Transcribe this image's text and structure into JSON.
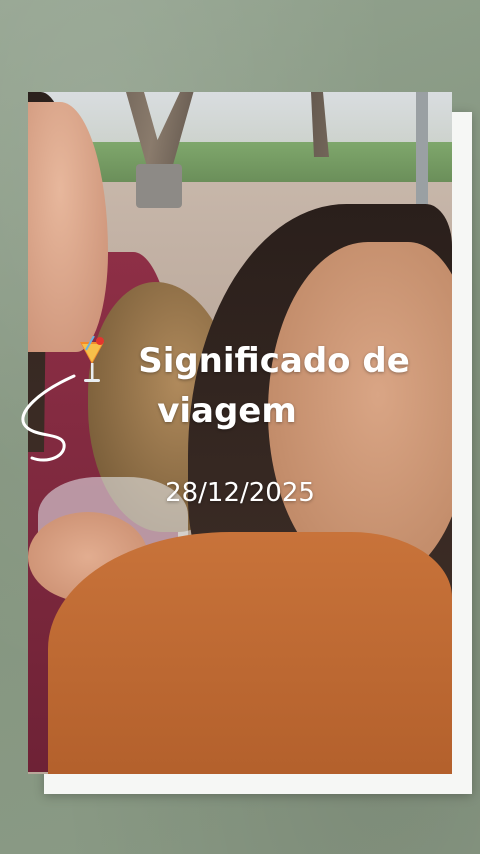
{
  "story": {
    "title_line1": "Significado de",
    "title_line2": "viagem",
    "date": "28/12/2025"
  },
  "icons": {
    "title_emoji": "cocktail-icon",
    "decoration": "swirl-icon"
  },
  "colors": {
    "background": "#8a9a86",
    "frame": "#f6f7f5",
    "text": "#ffffff"
  }
}
